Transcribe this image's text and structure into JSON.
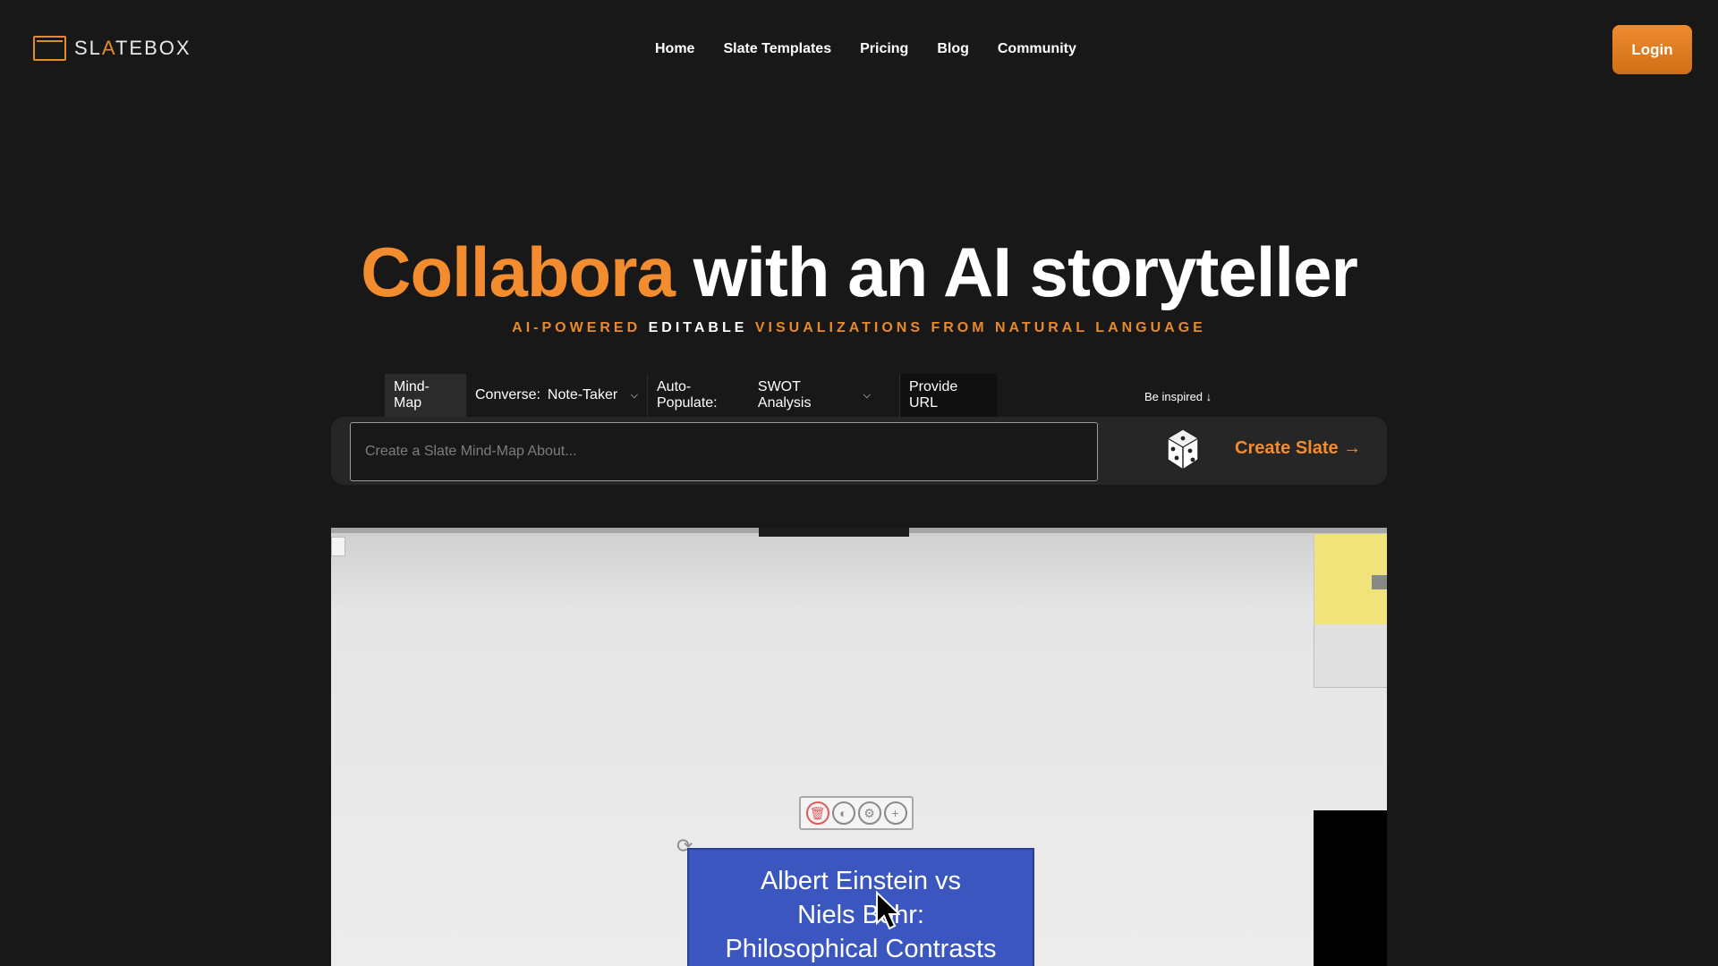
{
  "header": {
    "logo_text_pre": "SL",
    "logo_text_a": "A",
    "logo_text_post": "TEBOX",
    "nav": [
      "Home",
      "Slate Templates",
      "Pricing",
      "Blog",
      "Community"
    ],
    "login_label": "Login"
  },
  "hero": {
    "title_accent": "Collabora",
    "title_rest": "with an AI storyteller",
    "subtitle_part1": "AI-POWERED",
    "subtitle_part2": "EDITABLE",
    "subtitle_part3": "VISUALIZATIONS FROM NATURAL LANGUAGE"
  },
  "tabs": {
    "mindmap": "Mind-Map",
    "converse_label": "Converse:",
    "converse_value": "Note-Taker",
    "auto_label": "Auto-Populate:",
    "auto_value": "SWOT Analysis",
    "provide_url": "Provide URL"
  },
  "inspire_label": "Be inspired ↓",
  "search": {
    "placeholder": "Create a Slate Mind-Map About...",
    "value": ""
  },
  "create_label": "Create Slate →",
  "preview": {
    "node_lines": [
      "Albert Einstein vs",
      "Niels Bohr:",
      "Philosophical Contrasts"
    ]
  },
  "colors": {
    "accent": "#f28c2e",
    "background": "#181818",
    "node_blue": "#3b57bf"
  }
}
